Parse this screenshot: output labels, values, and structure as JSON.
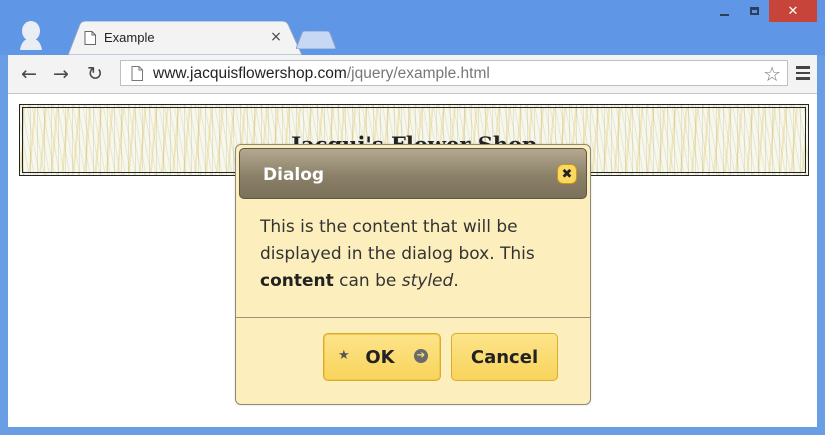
{
  "browser": {
    "tab": {
      "title": "Example",
      "close_glyph": "×"
    },
    "window_controls": {
      "close_glyph": "✕"
    },
    "nav": {
      "back_glyph": "←",
      "forward_glyph": "→",
      "reload_glyph": "↻"
    },
    "address_bar": {
      "host": "www.jacquisflowershop.com",
      "path": "/jquery/example.html"
    },
    "bookmark_glyph": "☆",
    "icons": [
      "profile-icon",
      "page-icon",
      "back-arrow-icon",
      "forward-arrow-icon",
      "reload-icon",
      "star-icon",
      "menu-icon"
    ]
  },
  "page": {
    "banner_title": "Jacqui's Flower Shop"
  },
  "dialog": {
    "title": "Dialog",
    "close_glyph": "✖",
    "content": {
      "line1": "This is the content that will be",
      "line2": "displayed in the dialog box. This",
      "strong": "content",
      "mid": " can be ",
      "em": "styled",
      "end": "."
    },
    "buttons": {
      "ok_label": "OK",
      "ok_left_icon": "★",
      "ok_right_icon": "➔",
      "cancel_label": "Cancel"
    }
  },
  "colors": {
    "chrome_blue": "#5f97e6",
    "dialog_bg": "#fcefbd",
    "button_yellow": "#f8d45c",
    "titlebar_brown": "#8b8068"
  }
}
